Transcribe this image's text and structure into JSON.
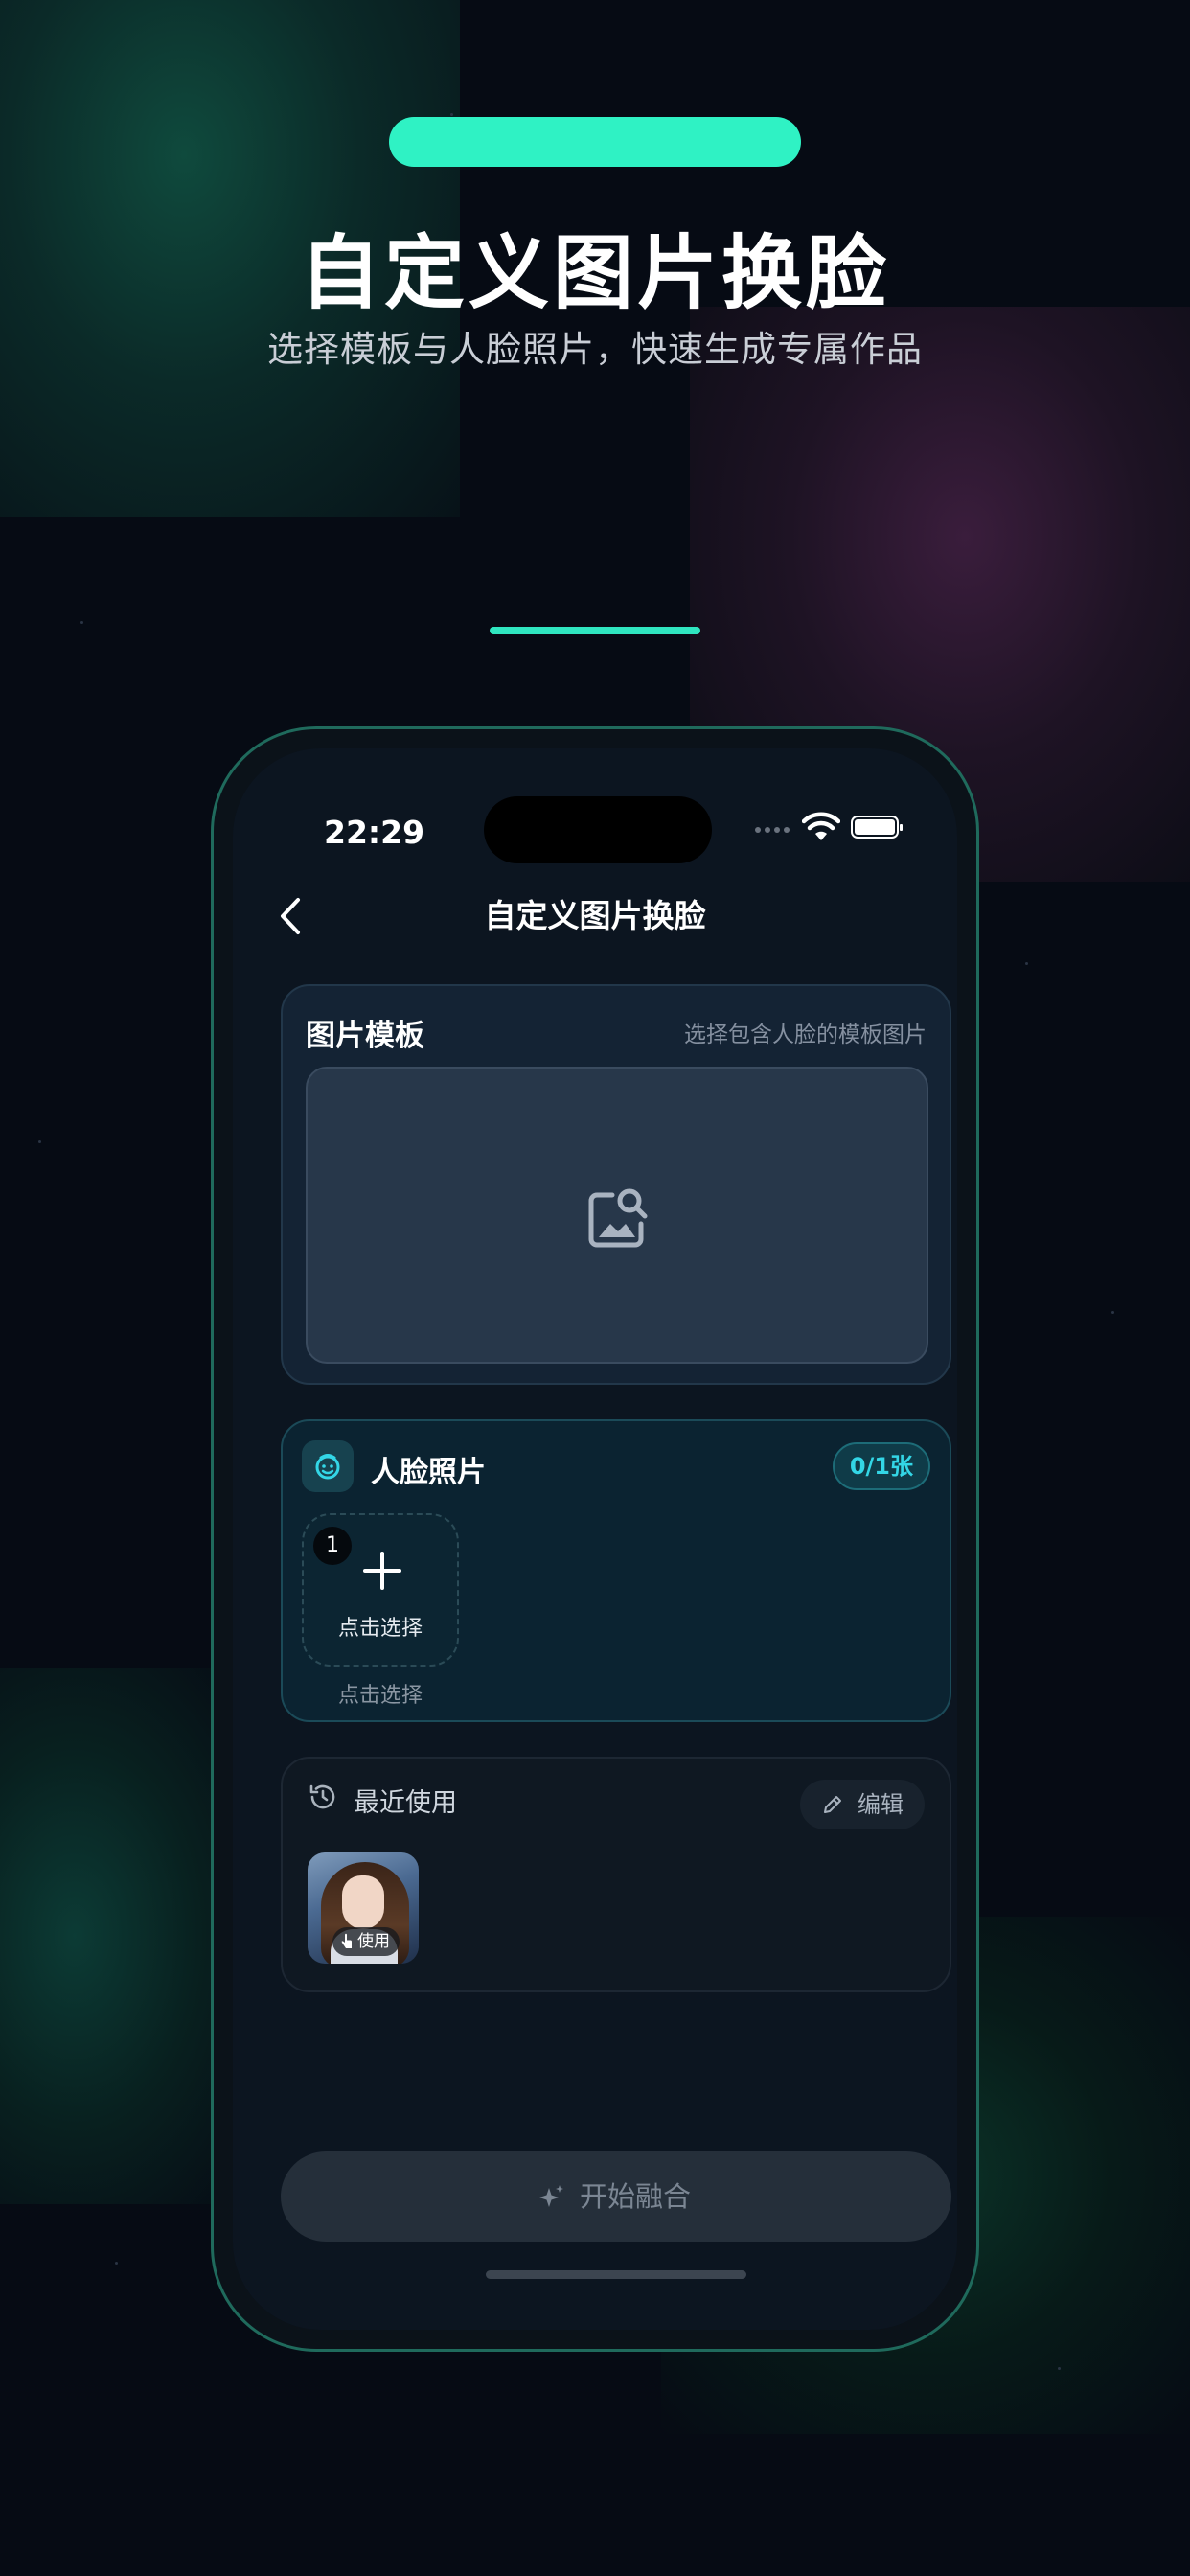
{
  "hero": {
    "title": "自定义图片换脸",
    "subtitle": "选择模板与人脸照片，快速生成专属作品"
  },
  "status_bar": {
    "time": "22:29"
  },
  "nav": {
    "title": "自定义图片换脸"
  },
  "template_card": {
    "title": "图片模板",
    "hint": "选择包含人脸的模板图片",
    "icon": "image-search-icon"
  },
  "face_card": {
    "title": "人脸照片",
    "count": "0/1张",
    "slot_number": "1",
    "slot_label": "点击选择",
    "slot_caption": "点击选择",
    "icon": "face-icon"
  },
  "recent_card": {
    "title": "最近使用",
    "edit_label": "编辑",
    "use_label": "使用",
    "icon": "history-icon"
  },
  "start_button": {
    "label": "开始融合",
    "icon": "sparkle-icon"
  },
  "colors": {
    "accent": "#2ff2c4",
    "badge_text": "#33d6e6",
    "background": "#060b14"
  }
}
